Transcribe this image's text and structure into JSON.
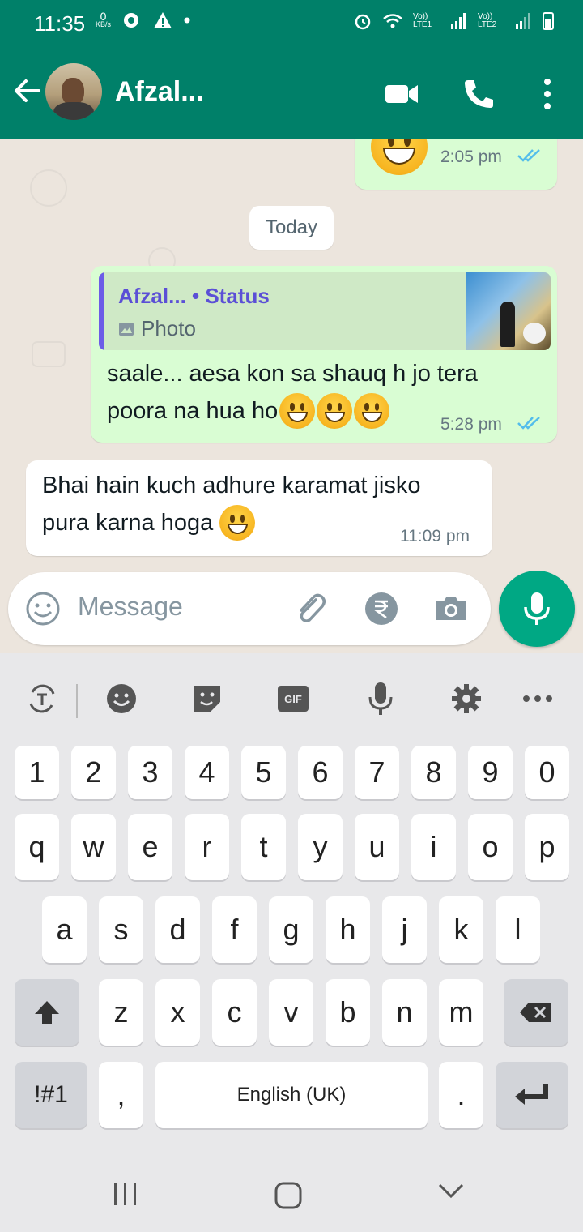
{
  "status_bar": {
    "time": "11:35",
    "net_speed": "0",
    "net_unit": "KB/s",
    "sim1": "Vo)) LTE1",
    "sim2": "Vo)) LTE2",
    "roaming": "R"
  },
  "header": {
    "contact_name": "Afzal...",
    "video_icon": "video-call-icon",
    "call_icon": "phone-icon",
    "menu_icon": "more-vert-icon"
  },
  "chat": {
    "date_chip": "Today",
    "messages": [
      {
        "direction": "out",
        "time": "2:05 pm",
        "status": "read"
      },
      {
        "direction": "out",
        "reply": {
          "name": "Afzal... • Status",
          "type": "Photo"
        },
        "text_line1": "saale... aesa kon sa shauq h jo tera",
        "text_line2": "poora na hua ho",
        "time": "5:28 pm",
        "status": "read"
      },
      {
        "direction": "in",
        "text_line1": "Bhai hain kuch adhure karamat jisko",
        "text_line2": "pura karna hoga",
        "time": "11:09 pm"
      }
    ]
  },
  "composer": {
    "placeholder": "Message",
    "emoji_icon": "emoji-icon",
    "attach_icon": "paperclip-icon",
    "payment_icon": "rupee-icon",
    "camera_icon": "camera-icon",
    "mic_icon": "mic-icon"
  },
  "keyboard": {
    "row_numbers": [
      "1",
      "2",
      "3",
      "4",
      "5",
      "6",
      "7",
      "8",
      "9",
      "0"
    ],
    "row1": [
      "q",
      "w",
      "e",
      "r",
      "t",
      "y",
      "u",
      "i",
      "o",
      "p"
    ],
    "row2": [
      "a",
      "s",
      "d",
      "f",
      "g",
      "h",
      "j",
      "k",
      "l"
    ],
    "row3": [
      "z",
      "x",
      "c",
      "v",
      "b",
      "n",
      "m"
    ],
    "symbols_key": "!#1",
    "comma_key": ",",
    "space_label": "English (UK)",
    "period_key": ".",
    "gif_label": "GIF"
  },
  "colors": {
    "header": "#008069",
    "outgoing_bubble": "#d9fdd3",
    "incoming_bubble": "#ffffff",
    "read_ticks": "#53bdeb",
    "fab": "#00a884"
  }
}
